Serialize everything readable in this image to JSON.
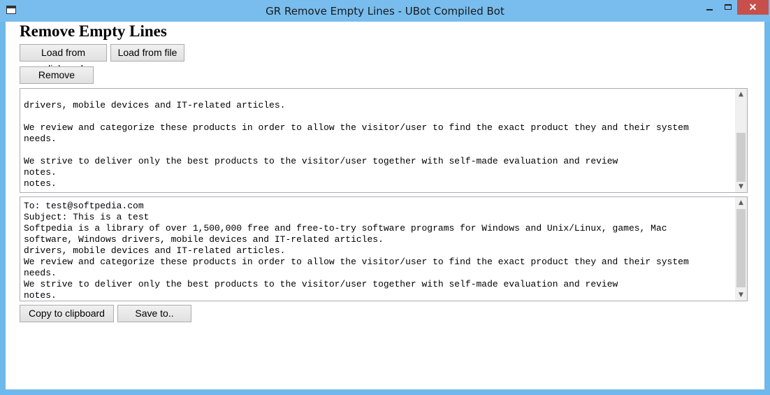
{
  "window": {
    "title": "GR Remove Empty Lines - UBot Compiled Bot",
    "min_symbol": "",
    "max_symbol": "",
    "close_symbol": "✕"
  },
  "header": {
    "title": "Remove Empty Lines"
  },
  "buttons": {
    "load_clipboard": "Load from clipboard",
    "load_file": "Load from file",
    "remove": "Remove",
    "copy_clipboard": "Copy to clipboard",
    "save_to": "Save to.."
  },
  "input_text": "\ndrivers, mobile devices and IT-related articles.\n\nWe review and categorize these products in order to allow the visitor/user to find the exact product they and their system\nneeds.\n\nWe strive to deliver only the best products to the visitor/user together with self-made evaluation and review\nnotes.\nnotes.",
  "output_text": "To: test@softpedia.com\nSubject: This is a test\nSoftpedia is a library of over 1,500,000 free and free-to-try software programs for Windows and Unix/Linux, games, Mac\nsoftware, Windows drivers, mobile devices and IT-related articles.\ndrivers, mobile devices and IT-related articles.\nWe review and categorize these products in order to allow the visitor/user to find the exact product they and their system\nneeds.\nWe strive to deliver only the best products to the visitor/user together with self-made evaluation and review\nnotes.",
  "scroll": {
    "up": "▲",
    "down": "▼"
  },
  "colors": {
    "titlebar": "#78bdee",
    "close": "#c7504c",
    "frame": "#6fb8ec"
  }
}
